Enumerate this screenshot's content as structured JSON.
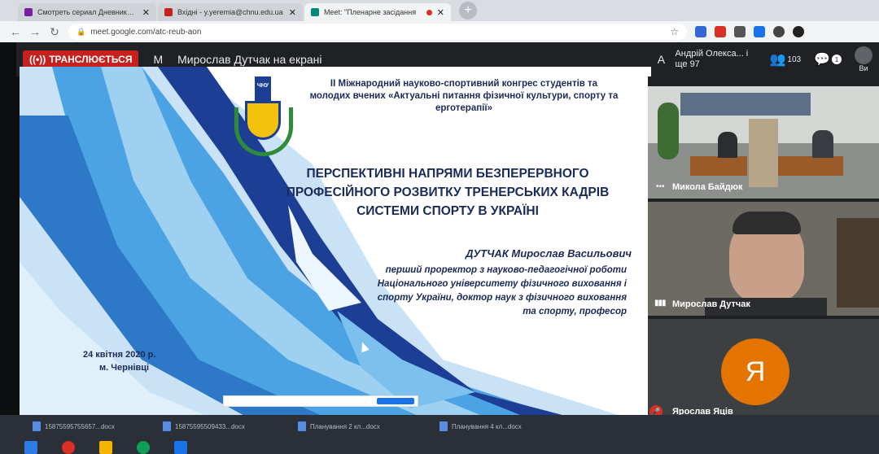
{
  "browser": {
    "tabs": [
      {
        "title": "Смотреть сериал Дневники вам",
        "icon_color": "#7a1fa2"
      },
      {
        "title": "Вхідні - y.yeremia@chnu.edu.ua",
        "icon_color": "#c5221f"
      },
      {
        "title": "Meet: \"Пленарне засідання",
        "icon_color": "#00897b"
      }
    ],
    "new_tab_glyph": "+",
    "close_glyph": "✕",
    "url": "meet.google.com/atc-reub-aon"
  },
  "meet": {
    "live_label": "ТРАНСЛЮЄТЬСЯ",
    "presenter_initial": "M",
    "presenter_text": "Мирослав Дутчак на екрані",
    "me_initial": "A",
    "user_name": "Андрій Олекса... і ще 97",
    "participants_count": "103",
    "chat_badge": "1",
    "you_label": "Ви"
  },
  "slide": {
    "header": "ІІ Міжнародний науково-спортивний конгрес студентів та молодих вчених «Актуальні питання фізичної культури, спорту та ерготерапії»",
    "logo_text": "ЧНУ",
    "title": "ПЕРСПЕКТИВНІ НАПРЯМИ БЕЗПЕРЕРВНОГО ПРОФЕСІЙНОГО РОЗВИТКУ ТРЕНЕРСЬКИХ КАДРІВ СИСТЕМИ СПОРТУ В УКРАЇНІ",
    "author": "ДУТЧАК Мирослав Васильович",
    "position": "перший проректор з науково-педагогічної роботи Національного університету фізичного виховання і спорту України, доктор наук з фізичного виховання та спорту, професор",
    "date": "24 квітня 2020 р.",
    "city": "м. Чернівці"
  },
  "participants": [
    {
      "name": "Микола Байдюк"
    },
    {
      "name": "Мирослав Дутчак"
    },
    {
      "name": "Ярослав Яців",
      "initial": "Я",
      "avatar_color": "#e37400"
    }
  ],
  "downloads": [
    {
      "name": "15875595755657...docx"
    },
    {
      "name": "15875595509433...docx"
    },
    {
      "name": "Планування 2 кл...docx"
    },
    {
      "name": "Планування 4 кл...docx"
    }
  ]
}
